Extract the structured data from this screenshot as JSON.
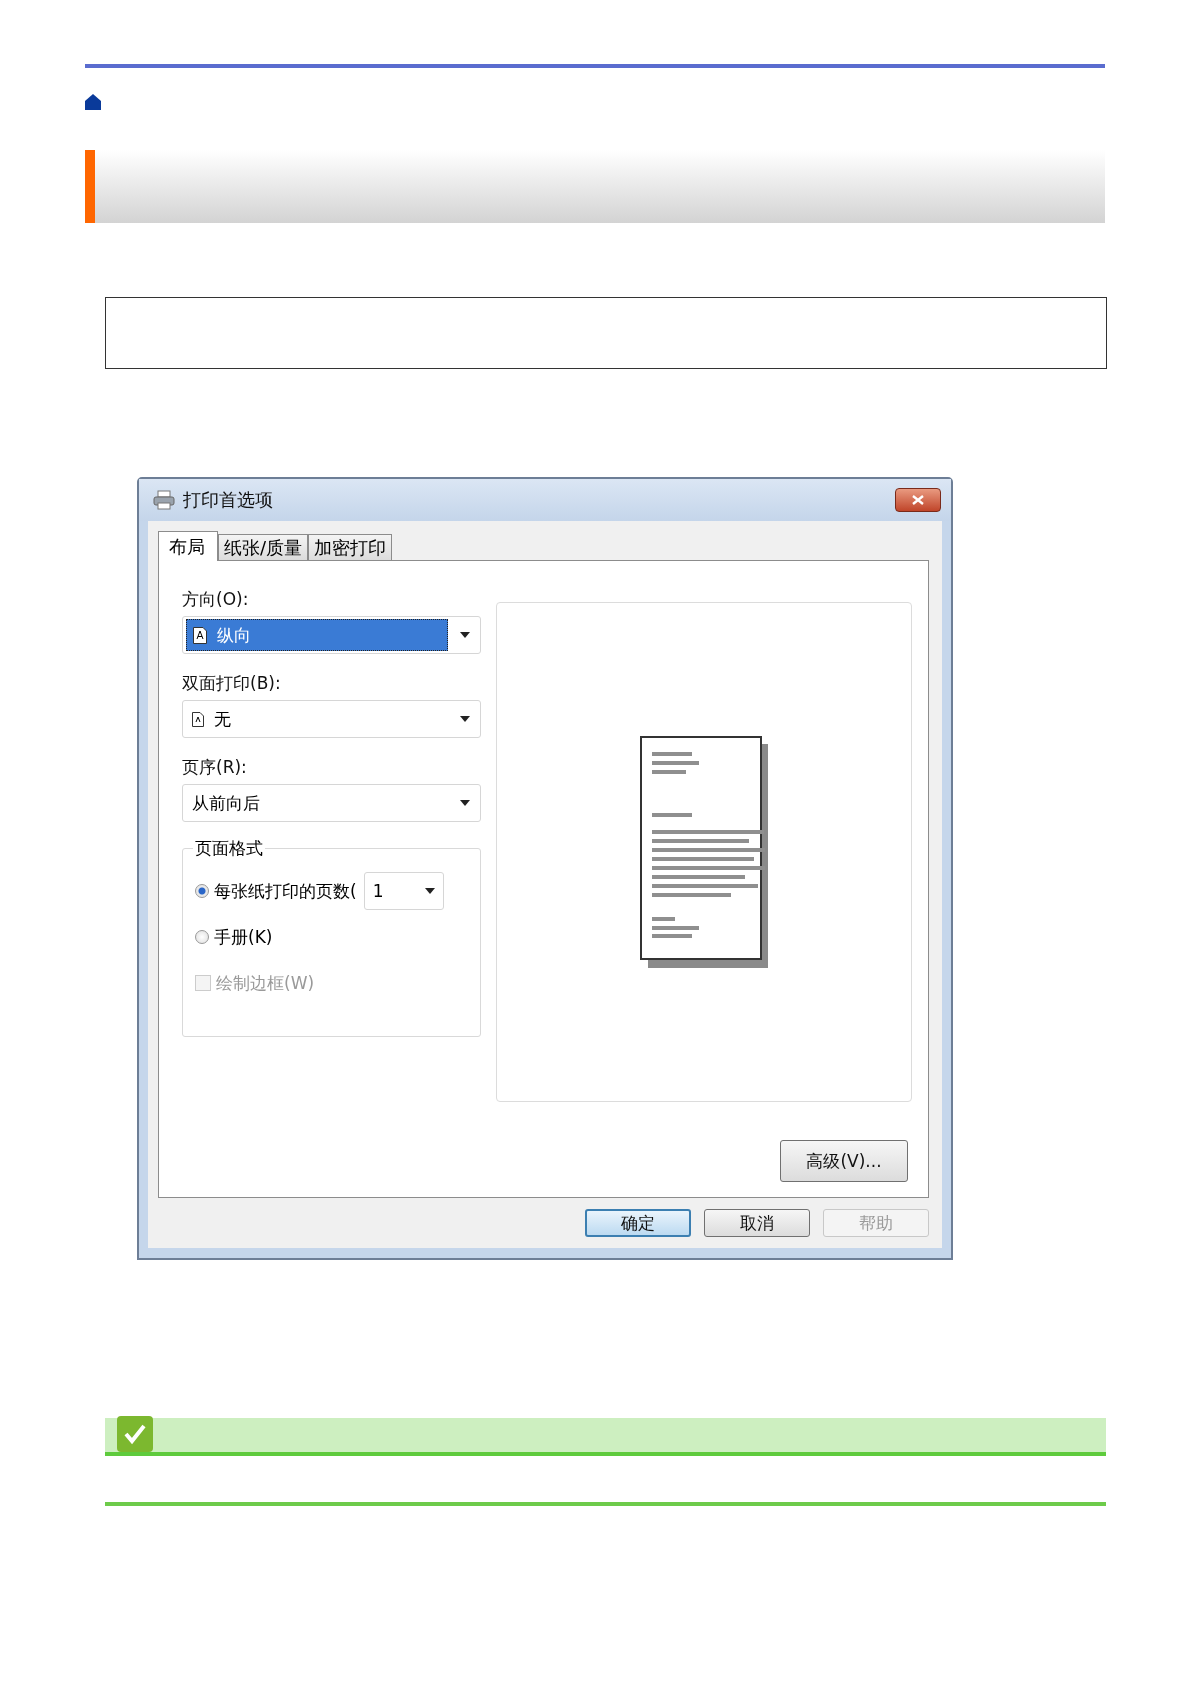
{
  "dialog": {
    "title": "打印首选项",
    "tabs": [
      {
        "label": "布局",
        "selected": true
      },
      {
        "label": "纸张/质量",
        "selected": false
      },
      {
        "label": "加密打印",
        "selected": false
      }
    ],
    "orientation": {
      "label": "方向(O):",
      "value": "纵向",
      "highlighted": true
    },
    "duplex": {
      "label": "双面打印(B):",
      "value": "无",
      "highlighted": false
    },
    "page_order": {
      "label": "页序(R):",
      "value": "从前向后",
      "highlighted": false
    },
    "page_format": {
      "title": "页面格式",
      "items": [
        {
          "kind": "radio",
          "label": "每张纸打印的页数(",
          "selected": true,
          "select_value": "1"
        },
        {
          "kind": "radio",
          "label": "手册(K)",
          "selected": false
        },
        {
          "kind": "checkbox",
          "label": "绘制边框(W)",
          "checked": false,
          "disabled": true
        }
      ]
    },
    "advanced_button": "高级(V)...",
    "buttons": [
      {
        "label": "确定",
        "default": true,
        "disabled": false
      },
      {
        "label": "取消",
        "default": false,
        "disabled": false
      },
      {
        "label": "帮助",
        "default": false,
        "disabled": true
      }
    ]
  }
}
